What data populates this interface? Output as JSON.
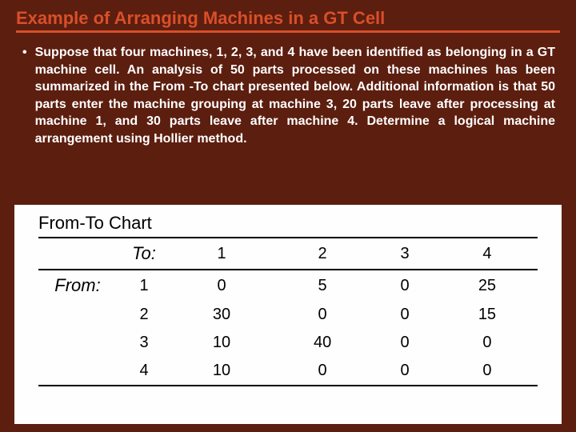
{
  "title": "Example of Arranging Machines in a GT Cell",
  "bullet": "Suppose that four machines, 1, 2, 3, and 4 have been identified as belonging in a GT machine cell. An analysis of 50 parts processed on these machines has been summarized in the From -To chart presented below. Additional information is that 50 parts enter the machine grouping at machine 3, 20 parts leave after processing at machine 1, and 30 parts leave after machine 4. Determine a logical machine arrangement using Hollier method.",
  "bullet_marker": "•",
  "chart": {
    "title": "From-To Chart",
    "to_label": "To:",
    "from_label": "From:"
  },
  "chart_data": {
    "type": "table",
    "title": "From-To Chart",
    "col_headers": [
      "1",
      "2",
      "3",
      "4"
    ],
    "row_headers": [
      "1",
      "2",
      "3",
      "4"
    ],
    "values": [
      [
        0,
        5,
        0,
        25
      ],
      [
        30,
        0,
        0,
        15
      ],
      [
        10,
        40,
        0,
        0
      ],
      [
        10,
        0,
        0,
        0
      ]
    ]
  }
}
